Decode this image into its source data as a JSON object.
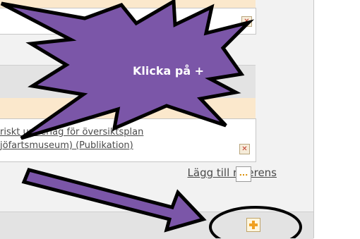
{
  "references": {
    "line1": "riskt underlag för översiktsplan",
    "line2": "jöfartsmuseum) (Publikation)",
    "add_link": "Lägg till referens",
    "remove_symbol": "✕",
    "browse_symbol": "..."
  },
  "callout": {
    "text": "Klicka på +"
  },
  "colors": {
    "callout_fill": "#7b56a8",
    "arrow_fill": "#7b56a8",
    "highlight_strip": "#fbe8cc"
  }
}
